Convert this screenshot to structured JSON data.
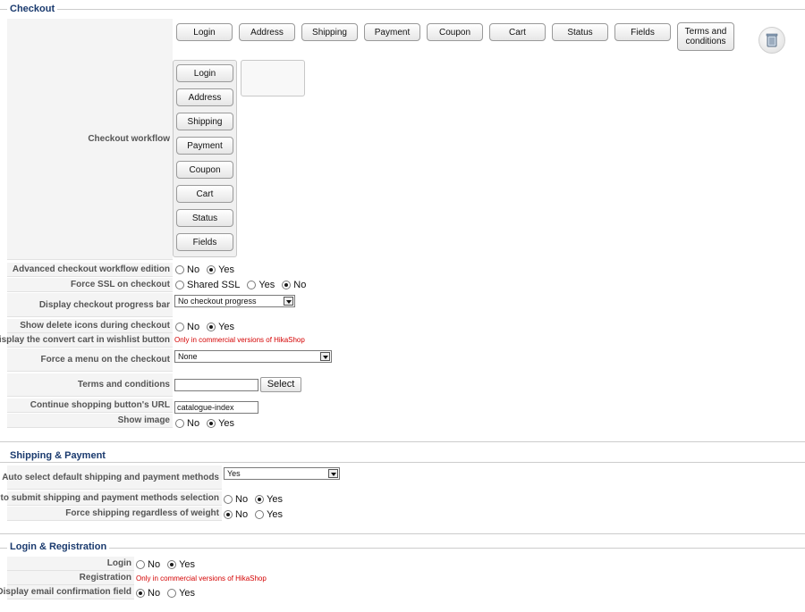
{
  "checkout": {
    "legend": "Checkout",
    "workflow_label": "Checkout workflow",
    "top_buttons": [
      "Login",
      "Address",
      "Shipping",
      "Payment",
      "Coupon",
      "Cart",
      "Status",
      "Fields",
      "Terms and conditions"
    ],
    "column_buttons": [
      "Login",
      "Address",
      "Shipping",
      "Payment",
      "Coupon",
      "Cart",
      "Status",
      "Fields"
    ],
    "trash_icon": "trash-icon",
    "advanced": {
      "label": "Advanced checkout workflow edition",
      "options": [
        "No",
        "Yes"
      ],
      "selected": "Yes"
    },
    "force_ssl": {
      "label": "Force SSL on checkout",
      "options": [
        "Shared SSL",
        "Yes",
        "No"
      ],
      "selected": "No"
    },
    "progress_bar": {
      "label": "Display checkout progress bar",
      "value": "No checkout progress"
    },
    "delete_icons": {
      "label": "Show delete icons during checkout",
      "options": [
        "No",
        "Yes"
      ],
      "selected": "Yes"
    },
    "convert_cart": {
      "label": "Display the convert cart in wishlist button",
      "note": "Only in commercial versions of HikaShop"
    },
    "force_menu": {
      "label": "Force a menu on the checkout",
      "value": "None"
    },
    "terms": {
      "label": "Terms and conditions",
      "value": "",
      "select_label": "Select"
    },
    "continue_url": {
      "label": "Continue shopping button's URL",
      "value": "catalogue-index"
    },
    "show_image": {
      "label": "Show image",
      "options": [
        "No",
        "Yes"
      ],
      "selected": "Yes"
    }
  },
  "shipping": {
    "legend": "Shipping & Payment",
    "auto_select": {
      "label": "Auto select default shipping and payment methods",
      "value": "Yes"
    },
    "auto_submit": {
      "label": "Auto submit shipping and payment methods selection",
      "options": [
        "No",
        "Yes"
      ],
      "selected": "Yes"
    },
    "force_shipping": {
      "label": "Force shipping regardless of weight",
      "options": [
        "No",
        "Yes"
      ],
      "selected": "No"
    }
  },
  "login": {
    "legend": "Login & Registration",
    "login": {
      "label": "Login",
      "options": [
        "No",
        "Yes"
      ],
      "selected": "Yes"
    },
    "registration": {
      "label": "Registration",
      "note": "Only in commercial versions of HikaShop"
    },
    "email_confirm": {
      "label": "Display email confirmation field",
      "options": [
        "No",
        "Yes"
      ],
      "selected": "No"
    }
  }
}
